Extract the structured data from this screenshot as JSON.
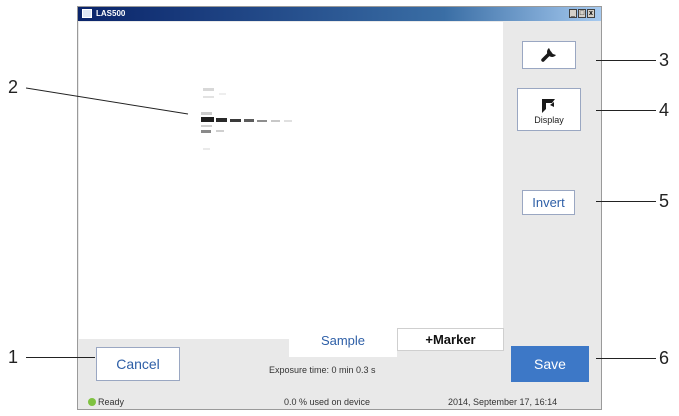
{
  "window": {
    "title": "LAS500"
  },
  "titlebar_buttons": {
    "minimize": "_",
    "maximize": "□",
    "close": "x"
  },
  "toolbar": {
    "settings_icon": "wrench-icon",
    "display_icon": "display-crop-icon",
    "display_label": "Display",
    "invert_label": "Invert"
  },
  "tabs": {
    "sample": "Sample",
    "marker": "+Marker",
    "active": "Sample"
  },
  "exposure": "Exposure time: 0 min 0.3 s",
  "actions": {
    "cancel": "Cancel",
    "save": "Save"
  },
  "status": {
    "indicator_color": "#7fc241",
    "state": "Ready",
    "storage": "0.0 % used on device",
    "datetime": "2014, September 17, 16:14"
  },
  "colors": {
    "accent": "#2e5fa7",
    "save_button": "#3d78c7",
    "panel": "#e9e9e9"
  },
  "callouts": [
    "1",
    "2",
    "3",
    "4",
    "5",
    "6"
  ]
}
